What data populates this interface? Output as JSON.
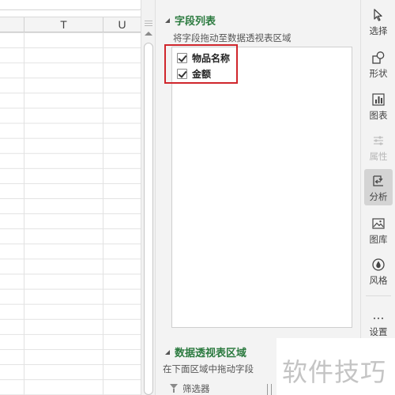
{
  "spreadsheet": {
    "columns": [
      "T",
      "U"
    ]
  },
  "field_list": {
    "title": "字段列表",
    "hint": "将字段拖动至数据透视表区域",
    "fields": [
      {
        "label": "物品名称",
        "checked": true
      },
      {
        "label": "金额",
        "checked": true
      }
    ]
  },
  "pivot_areas": {
    "title": "数据透视表区域",
    "hint": "在下面区域中拖动字段",
    "filter_label": "筛选器"
  },
  "toolbar": {
    "items": [
      {
        "label": "选择",
        "icon": "cursor-icon"
      },
      {
        "label": "形状",
        "icon": "shapes-icon"
      },
      {
        "label": "图表",
        "icon": "chart-icon"
      },
      {
        "label": "属性",
        "icon": "properties-icon"
      },
      {
        "label": "分析",
        "icon": "analysis-icon"
      },
      {
        "label": "图库",
        "icon": "gallery-icon"
      },
      {
        "label": "风格",
        "icon": "style-icon"
      },
      {
        "label": "设置",
        "icon": "more-icon"
      }
    ]
  },
  "watermark": {
    "text": "软件技巧"
  },
  "colors": {
    "section_title": "#2b7a3f",
    "highlight_border": "#d0262c",
    "active_tool_bg": "#d4d4d4"
  }
}
